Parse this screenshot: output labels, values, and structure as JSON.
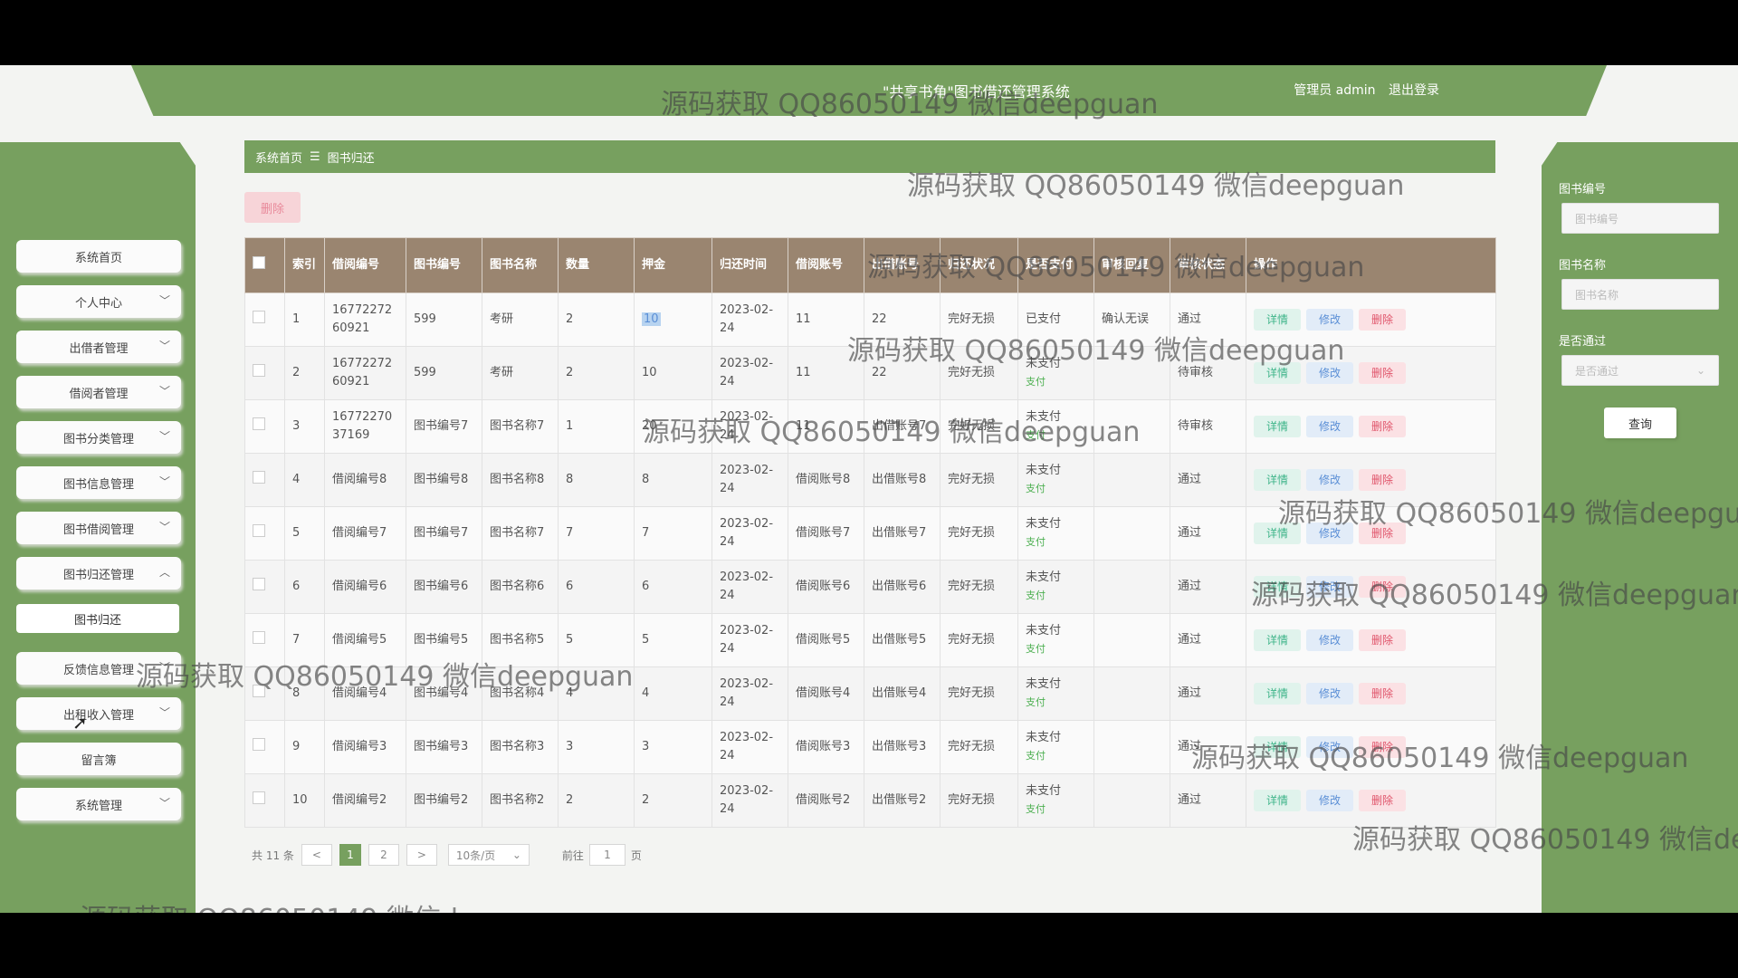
{
  "header": {
    "title": "\"共享书角\"图书借还管理系统",
    "user_role": "管理员 admin",
    "logout": "退出登录"
  },
  "sidebar": {
    "items": [
      {
        "label": "系统首页",
        "expand": false
      },
      {
        "label": "个人中心",
        "expand": true
      },
      {
        "label": "出借者管理",
        "expand": true
      },
      {
        "label": "借阅者管理",
        "expand": true
      },
      {
        "label": "图书分类管理",
        "expand": true
      },
      {
        "label": "图书信息管理",
        "expand": true
      },
      {
        "label": "图书借阅管理",
        "expand": true
      },
      {
        "label": "图书归还管理",
        "expand": true,
        "open": true
      },
      {
        "label": "反馈信息管理",
        "expand": true
      },
      {
        "label": "出租收入管理",
        "expand": true
      },
      {
        "label": "留言簿",
        "expand": false
      },
      {
        "label": "系统管理",
        "expand": true
      }
    ],
    "submenu": "图书归还"
  },
  "breadcrumb": {
    "home": "系统首页",
    "separator": "☰",
    "current": "图书归还"
  },
  "toolbar": {
    "delete": "删除"
  },
  "table": {
    "headers": [
      "索引",
      "借阅编号",
      "图书编号",
      "图书名称",
      "数量",
      "押金",
      "归还时间",
      "借阅账号",
      "出借账号",
      "归还状况",
      "是否支付",
      "审核回复",
      "审核状态",
      "操作"
    ],
    "rows": [
      {
        "idx": "1",
        "borrow_no": "1677227260921",
        "book_no": "599",
        "book_name": "考研",
        "qty": "2",
        "deposit": "10",
        "return_time": "2023-02-24",
        "borrow_acct": "11",
        "lend_acct": "22",
        "condition": "完好无损",
        "paid": "已支付",
        "pay_link": "",
        "reply": "确认无误",
        "status": "通过"
      },
      {
        "idx": "2",
        "borrow_no": "1677227260921",
        "book_no": "599",
        "book_name": "考研",
        "qty": "2",
        "deposit": "10",
        "return_time": "2023-02-24",
        "borrow_acct": "11",
        "lend_acct": "22",
        "condition": "完好无损",
        "paid": "未支付",
        "pay_link": "支付",
        "reply": "",
        "status": "待审核"
      },
      {
        "idx": "3",
        "borrow_no": "1677227037169",
        "book_no": "图书编号7",
        "book_name": "图书名称7",
        "qty": "1",
        "deposit": "20",
        "return_time": "2023-02-24",
        "borrow_acct": "11",
        "lend_acct": "出借账号7",
        "condition": "完好无损",
        "paid": "未支付",
        "pay_link": "支付",
        "reply": "",
        "status": "待审核"
      },
      {
        "idx": "4",
        "borrow_no": "借阅编号8",
        "book_no": "图书编号8",
        "book_name": "图书名称8",
        "qty": "8",
        "deposit": "8",
        "return_time": "2023-02-24",
        "borrow_acct": "借阅账号8",
        "lend_acct": "出借账号8",
        "condition": "完好无损",
        "paid": "未支付",
        "pay_link": "支付",
        "reply": "",
        "status": "通过"
      },
      {
        "idx": "5",
        "borrow_no": "借阅编号7",
        "book_no": "图书编号7",
        "book_name": "图书名称7",
        "qty": "7",
        "deposit": "7",
        "return_time": "2023-02-24",
        "borrow_acct": "借阅账号7",
        "lend_acct": "出借账号7",
        "condition": "完好无损",
        "paid": "未支付",
        "pay_link": "支付",
        "reply": "",
        "status": "通过"
      },
      {
        "idx": "6",
        "borrow_no": "借阅编号6",
        "book_no": "图书编号6",
        "book_name": "图书名称6",
        "qty": "6",
        "deposit": "6",
        "return_time": "2023-02-24",
        "borrow_acct": "借阅账号6",
        "lend_acct": "出借账号6",
        "condition": "完好无损",
        "paid": "未支付",
        "pay_link": "支付",
        "reply": "",
        "status": "通过"
      },
      {
        "idx": "7",
        "borrow_no": "借阅编号5",
        "book_no": "图书编号5",
        "book_name": "图书名称5",
        "qty": "5",
        "deposit": "5",
        "return_time": "2023-02-24",
        "borrow_acct": "借阅账号5",
        "lend_acct": "出借账号5",
        "condition": "完好无损",
        "paid": "未支付",
        "pay_link": "支付",
        "reply": "",
        "status": "通过"
      },
      {
        "idx": "8",
        "borrow_no": "借阅编号4",
        "book_no": "图书编号4",
        "book_name": "图书名称4",
        "qty": "4",
        "deposit": "4",
        "return_time": "2023-02-24",
        "borrow_acct": "借阅账号4",
        "lend_acct": "出借账号4",
        "condition": "完好无损",
        "paid": "未支付",
        "pay_link": "支付",
        "reply": "",
        "status": "通过"
      },
      {
        "idx": "9",
        "borrow_no": "借阅编号3",
        "book_no": "图书编号3",
        "book_name": "图书名称3",
        "qty": "3",
        "deposit": "3",
        "return_time": "2023-02-24",
        "borrow_acct": "借阅账号3",
        "lend_acct": "出借账号3",
        "condition": "完好无损",
        "paid": "未支付",
        "pay_link": "支付",
        "reply": "",
        "status": "通过"
      },
      {
        "idx": "10",
        "borrow_no": "借阅编号2",
        "book_no": "图书编号2",
        "book_name": "图书名称2",
        "qty": "2",
        "deposit": "2",
        "return_time": "2023-02-24",
        "borrow_acct": "借阅账号2",
        "lend_acct": "出借账号2",
        "condition": "完好无损",
        "paid": "未支付",
        "pay_link": "支付",
        "reply": "",
        "status": "通过"
      }
    ],
    "actions": {
      "detail": "详情",
      "edit": "修改",
      "delete": "删除"
    }
  },
  "pagination": {
    "total": "共 11 条",
    "prev": "<",
    "pages": [
      "1",
      "2"
    ],
    "next": ">",
    "page_size": "10条/页",
    "goto_label": "前往",
    "goto_value": "1",
    "page_unit": "页"
  },
  "search": {
    "book_no_label": "图书编号",
    "book_no_placeholder": "图书编号",
    "book_name_label": "图书名称",
    "book_name_placeholder": "图书名称",
    "passed_label": "是否通过",
    "passed_placeholder": "是否通过",
    "query": "查询"
  },
  "watermark": "源码获取 QQ86050149 微信deepguan",
  "colors": {
    "brand_green": "#77a05f",
    "table_header": "#9a8570",
    "detail": "#3eb489",
    "edit": "#5b8fd6",
    "delete": "#e0556b"
  }
}
